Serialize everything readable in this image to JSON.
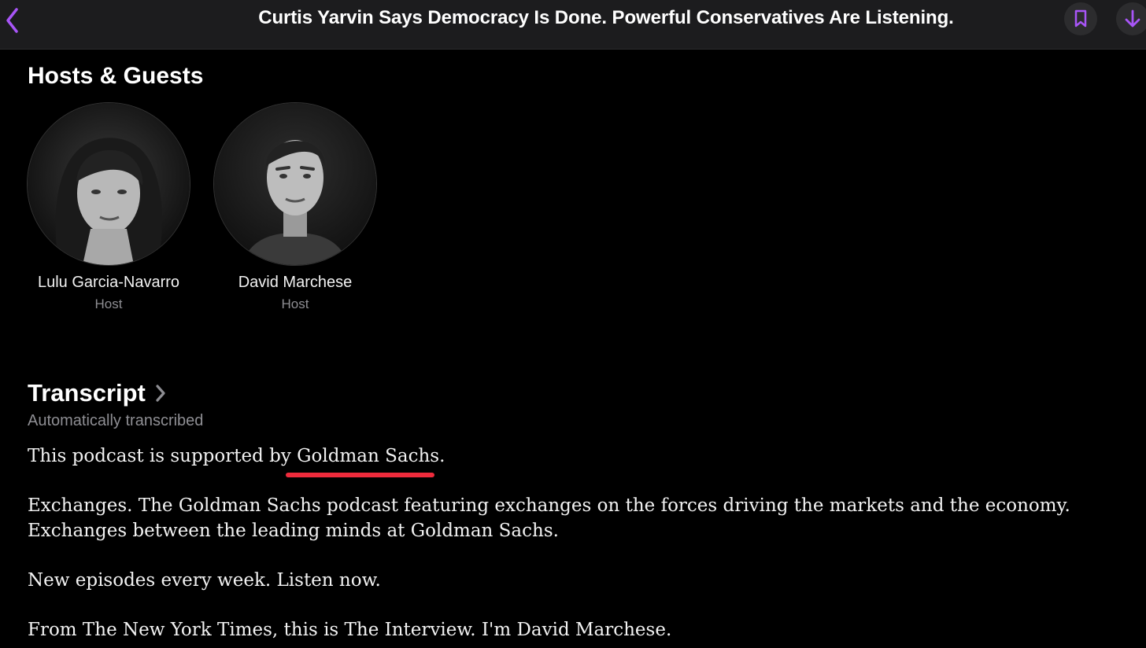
{
  "header": {
    "title": "Curtis Yarvin Says Democracy Is Done. Powerful Conservatives Are Listening.",
    "back_icon": "chevron-left-icon",
    "bookmark_icon": "bookmark-icon",
    "download_icon": "arrow-down-icon"
  },
  "hosts": {
    "heading": "Hosts & Guests",
    "people": [
      {
        "name": "Lulu Garcia-Navarro",
        "role": "Host"
      },
      {
        "name": "David Marchese",
        "role": "Host"
      }
    ]
  },
  "transcript": {
    "title": "Transcript",
    "subtitle": "Automatically transcribed",
    "paragraphs": [
      "This podcast is supported by Goldman Sachs.",
      "Exchanges. The Goldman Sachs podcast featuring exchanges on the forces driving the markets and the economy. Exchanges between the leading minds at Goldman Sachs.",
      "New episodes every week. Listen now.",
      "From The New York Times, this is The Interview. I'm David Marchese."
    ]
  },
  "colors": {
    "accent": "#a855f7",
    "background": "#000000",
    "bar": "#1c1c1e",
    "underline": "#ef2b3c"
  }
}
